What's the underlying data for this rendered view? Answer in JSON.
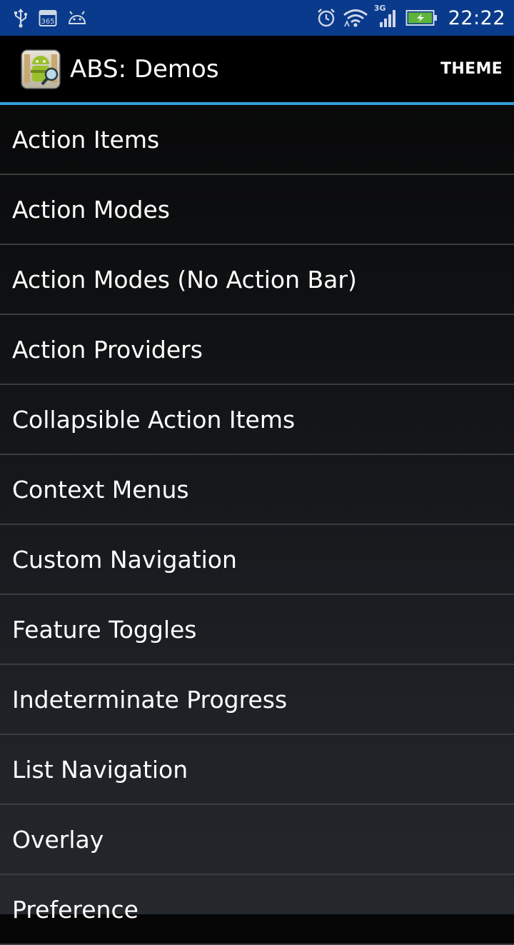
{
  "status_bar": {
    "time": "22:22",
    "network_type": "3G",
    "left_icons": [
      "usb-icon",
      "calendar-365-icon",
      "android-debug-icon"
    ],
    "right_icons": [
      "alarm-icon",
      "wifi-icon",
      "signal-icon",
      "battery-charging-icon"
    ],
    "calendar_badge": "365"
  },
  "action_bar": {
    "title": "ABS: Demos",
    "theme_label": "THEME",
    "accent_color": "#2f9fd8"
  },
  "list": {
    "items": [
      {
        "label": "Action Items"
      },
      {
        "label": "Action Modes"
      },
      {
        "label": "Action Modes (No Action Bar)"
      },
      {
        "label": "Action Providers"
      },
      {
        "label": "Collapsible Action Items"
      },
      {
        "label": "Context Menus"
      },
      {
        "label": "Custom Navigation"
      },
      {
        "label": "Feature Toggles"
      },
      {
        "label": "Indeterminate Progress"
      },
      {
        "label": "List Navigation"
      },
      {
        "label": "Overlay"
      },
      {
        "label": "Preference"
      }
    ]
  }
}
